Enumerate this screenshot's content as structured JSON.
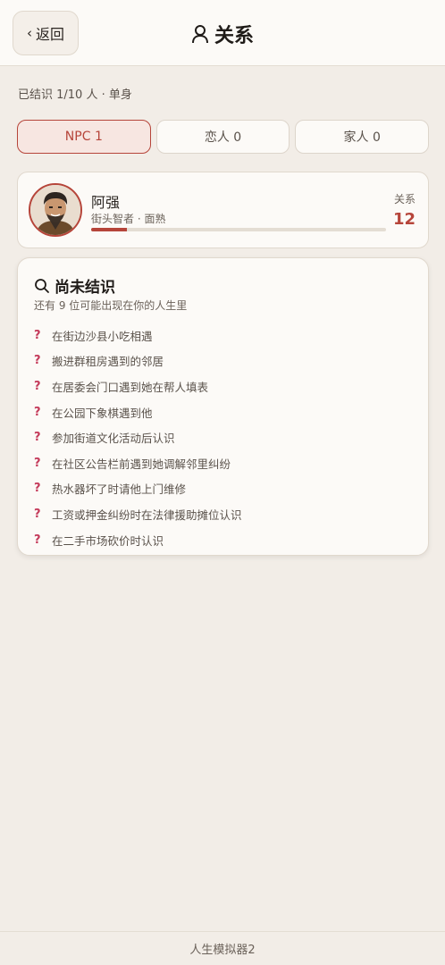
{
  "header": {
    "back_label": "返回",
    "title": "关系"
  },
  "summary": "已结识 1/10 人 · 单身",
  "tabs": [
    {
      "label": "NPC 1",
      "active": true
    },
    {
      "label": "恋人 0",
      "active": false
    },
    {
      "label": "家人 0",
      "active": false
    }
  ],
  "npc": {
    "name": "阿强",
    "subtitle": "街头智者 · 面熟",
    "relation_label": "关系",
    "relation_value": "12",
    "relation_progress": 0.12
  },
  "unknown": {
    "title": "尚未结识",
    "subtitle": "还有 9 位可能出现在你的人生里",
    "hints": [
      "在街边沙县小吃相遇",
      "搬进群租房遇到的邻居",
      "在居委会门口遇到她在帮人填表",
      "在公园下象棋遇到他",
      "参加街道文化活动后认识",
      "在社区公告栏前遇到她调解邻里纠纷",
      "热水器坏了时请他上门维修",
      "工资或押金纠纷时在法律援助摊位认识",
      "在二手市场砍价时认识"
    ]
  },
  "footer": "人生模拟器2",
  "colors": {
    "accent": "#b6453a",
    "hint_icon": "#c43a5a",
    "background": "#f2ede7"
  },
  "icons": {
    "back": "chevron-left-icon",
    "title": "person-icon",
    "search": "search-icon",
    "hint": "question-icon"
  }
}
